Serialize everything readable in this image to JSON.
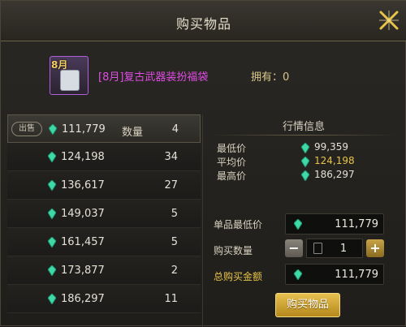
{
  "dialog": {
    "title": "购买物品"
  },
  "item": {
    "badge": "8月",
    "name": "[8月]复古武器装扮福袋",
    "owned_label": "拥有：0"
  },
  "listings": {
    "sale_tag": "出售",
    "quantity_label": "数量",
    "rows": [
      {
        "price": "111,779",
        "qty": "4"
      },
      {
        "price": "124,198",
        "qty": "34"
      },
      {
        "price": "136,617",
        "qty": "27"
      },
      {
        "price": "149,037",
        "qty": "5"
      },
      {
        "price": "161,457",
        "qty": "5"
      },
      {
        "price": "173,877",
        "qty": "2"
      },
      {
        "price": "186,297",
        "qty": "11"
      }
    ]
  },
  "market": {
    "title": "行情信息",
    "min_label": "最低价",
    "min_value": "99,359",
    "avg_label": "平均价",
    "avg_value": "124,198",
    "max_label": "最高价",
    "max_value": "186,297"
  },
  "form": {
    "unit_min_label": "单品最低价",
    "unit_min_value": "111,779",
    "buy_qty_label": "购买数量",
    "buy_qty_value": "1",
    "total_label": "总购买金额",
    "total_value": "111,779",
    "buy_button": "购买物品"
  },
  "colors": {
    "gem": "#3fd9a8",
    "gold": "#e8c34a",
    "item_name": "#e24ce6"
  }
}
